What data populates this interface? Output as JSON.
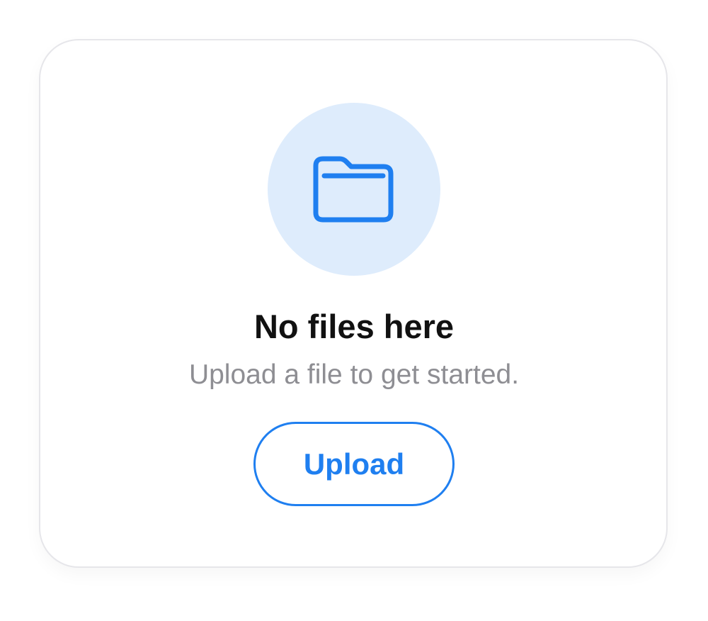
{
  "empty_state": {
    "icon": "folder-icon",
    "title": "No files here",
    "subtitle": "Upload a file to get started.",
    "button_label": "Upload"
  },
  "colors": {
    "accent": "#1f7ff0",
    "icon_circle_bg": "#deecfc",
    "title": "#111111",
    "subtitle": "#8e8e93",
    "card_border": "#e6e6ea"
  }
}
